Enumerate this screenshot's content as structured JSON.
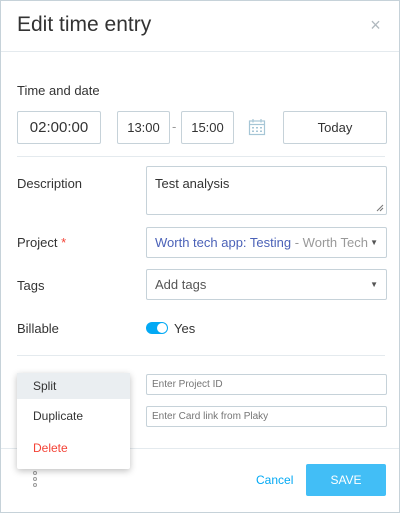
{
  "modal": {
    "title": "Edit time entry",
    "close_label": "×"
  },
  "time": {
    "label": "Time and date",
    "duration": "02:00:00",
    "start": "13:00",
    "end": "15:00",
    "separator": "-",
    "today_label": "Today"
  },
  "description": {
    "label": "Description",
    "value": "Test analysis"
  },
  "project": {
    "label": "Project",
    "required_mark": "*",
    "name": "Worth tech app: Testing",
    "client": "- Worth Tech"
  },
  "tags": {
    "label": "Tags",
    "placeholder": "Add tags"
  },
  "billable": {
    "label": "Billable",
    "value": "Yes",
    "enabled": true
  },
  "extra_fields": {
    "project_id_placeholder": "Enter Project ID",
    "card_link_placeholder": "Enter Card link from Plaky"
  },
  "menu": {
    "items": [
      {
        "label": "Split"
      },
      {
        "label": "Duplicate"
      },
      {
        "label": "Delete"
      }
    ]
  },
  "footer": {
    "cancel_label": "Cancel",
    "save_label": "SAVE"
  },
  "colors": {
    "accent": "#03a9f4",
    "project": "#4b62b8",
    "danger": "#f44336"
  }
}
